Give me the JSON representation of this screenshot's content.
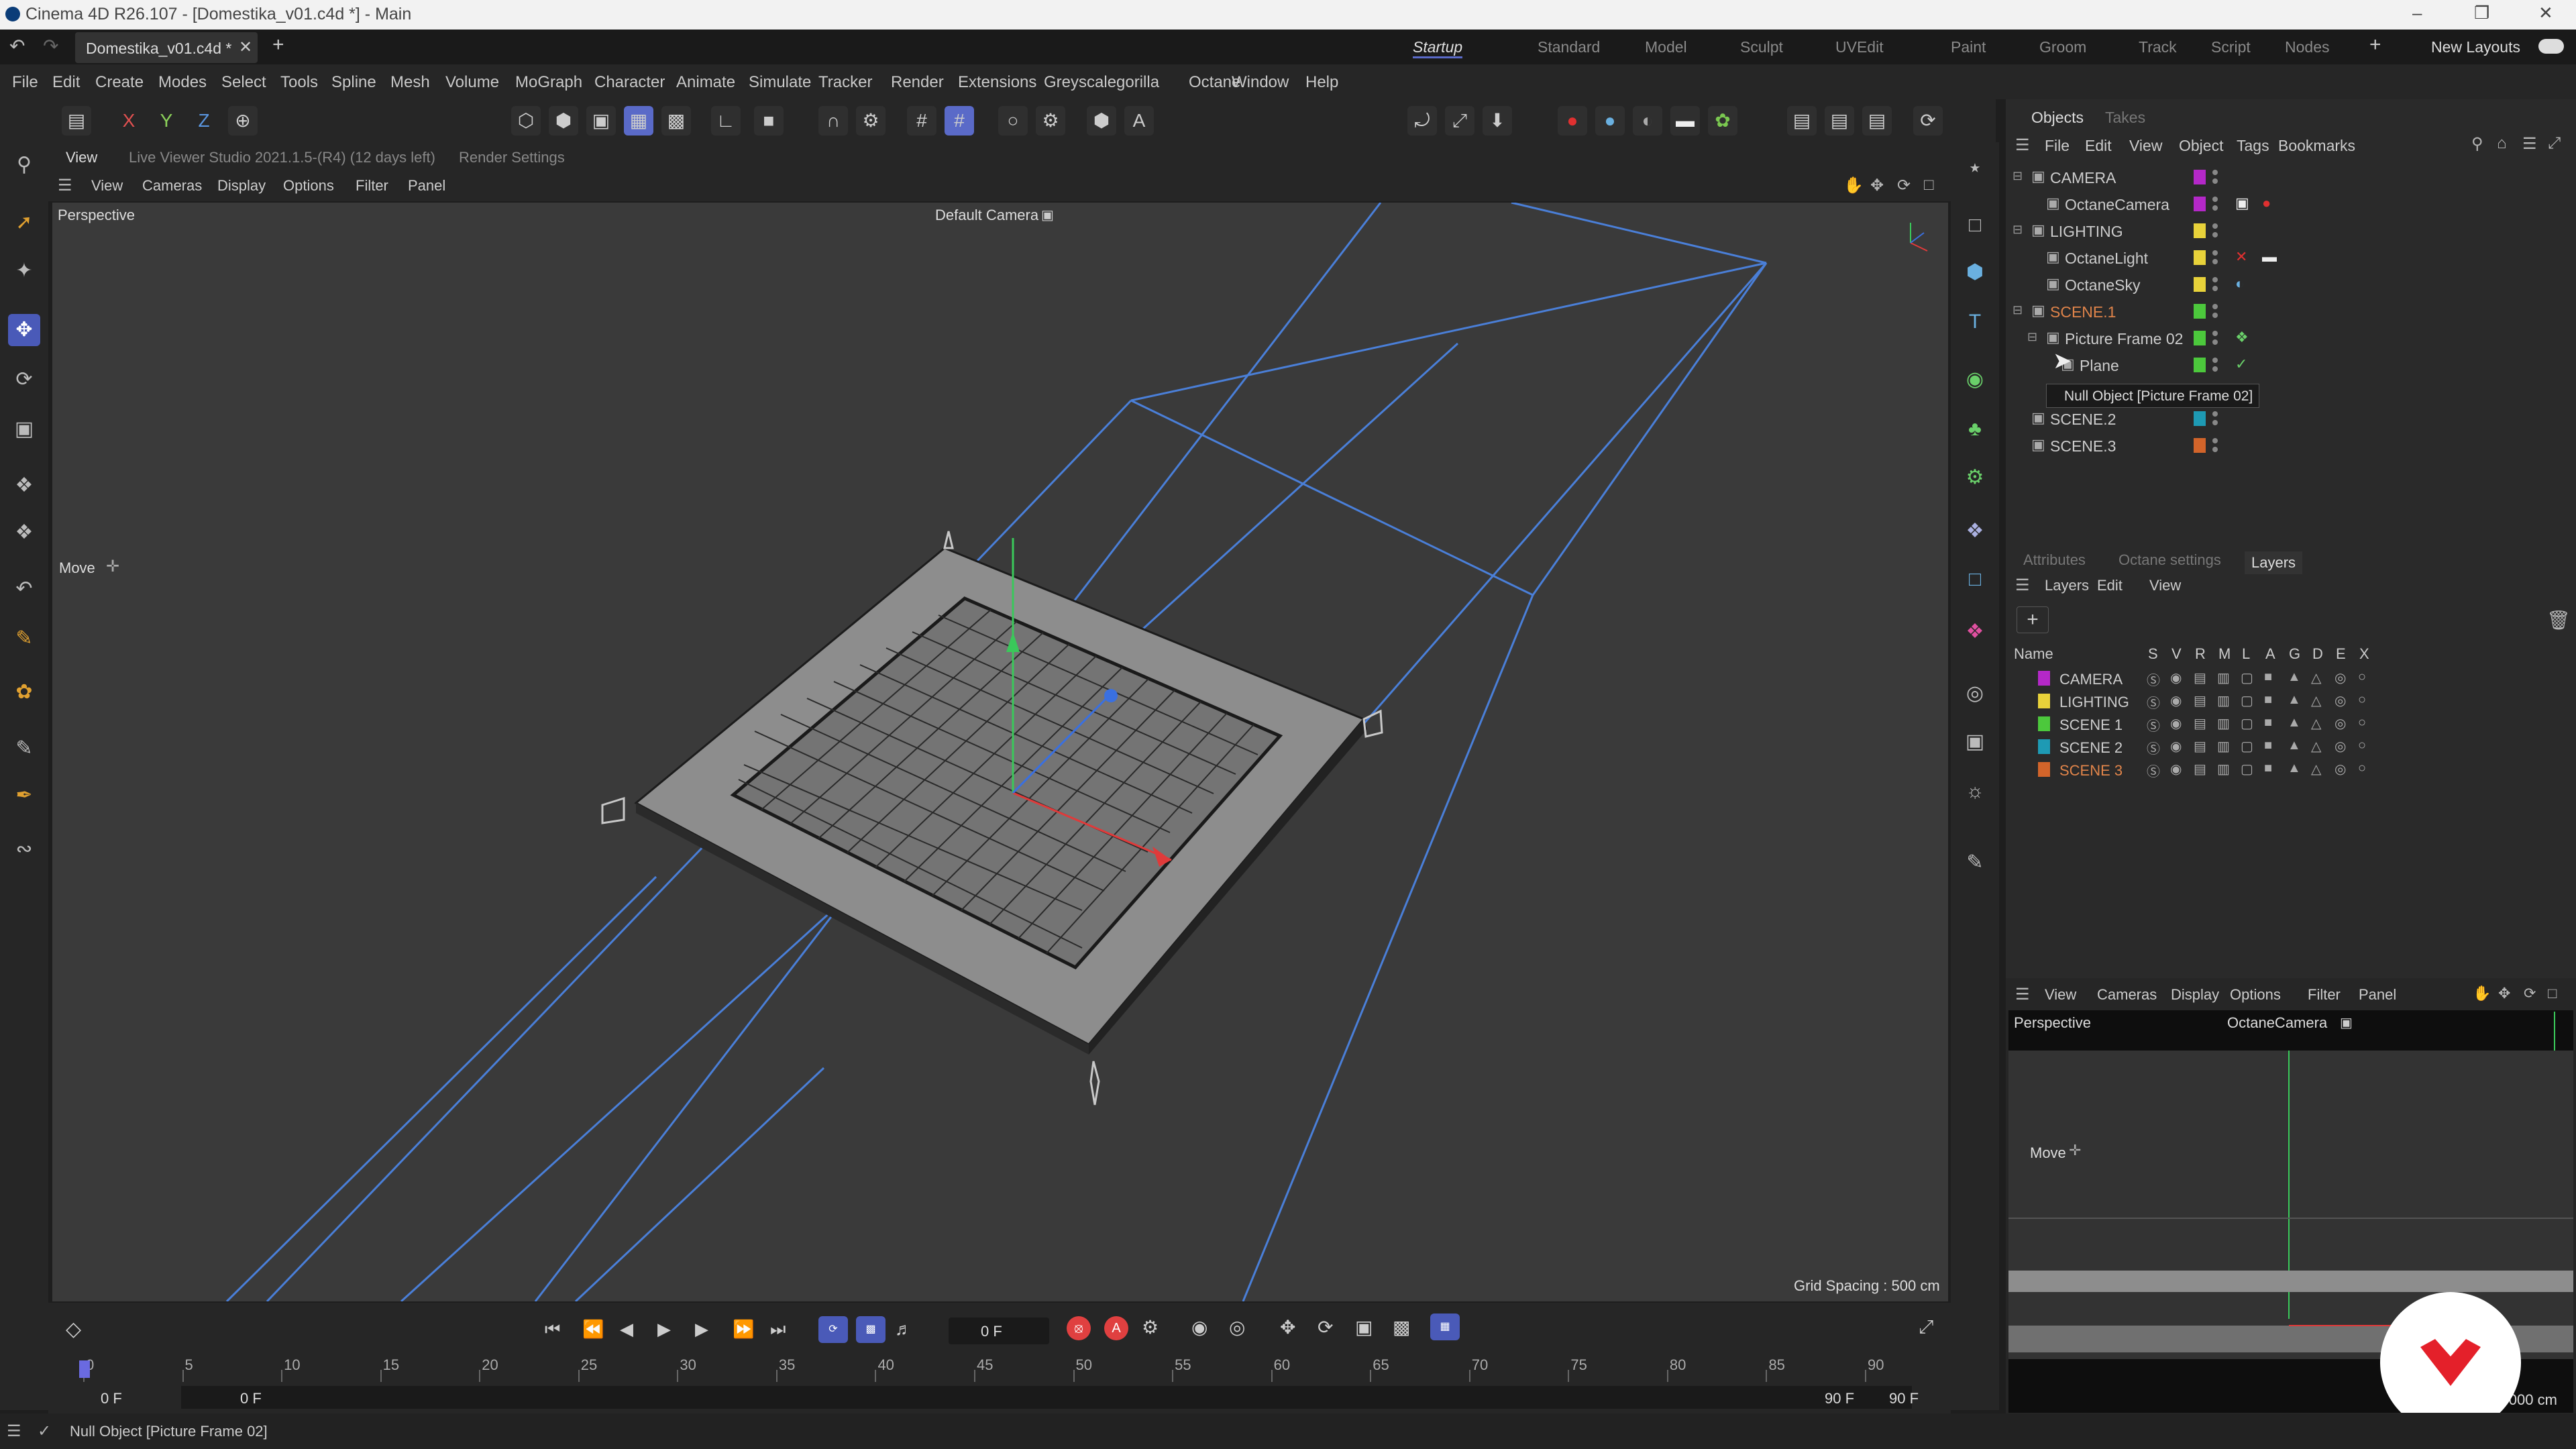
{
  "window": {
    "title": "Cinema 4D R26.107 - [Domestika_v01.c4d *] - Main"
  },
  "tabs": {
    "file_tab": "Domestika_v01.c4d *",
    "layouts": [
      "Startup",
      "Standard",
      "Model",
      "Sculpt",
      "UVEdit",
      "Paint",
      "Groom",
      "Track",
      "Script",
      "Nodes"
    ],
    "new_layouts": "New Layouts"
  },
  "menu": [
    "File",
    "Edit",
    "Create",
    "Modes",
    "Select",
    "Tools",
    "Spline",
    "Mesh",
    "Volume",
    "MoGraph",
    "Character",
    "Animate",
    "Simulate",
    "Tracker",
    "Render",
    "Extensions",
    "Greyscalegorilla",
    "Octane",
    "Window",
    "Help"
  ],
  "coords": [
    "X",
    "Y",
    "Z"
  ],
  "viewport": {
    "tab_view": "View",
    "live_viewer": "Live Viewer Studio 2021.1.5-(R4) (12 days left)",
    "render_settings": "Render Settings",
    "menu": [
      "View",
      "Cameras",
      "Display",
      "Options",
      "Filter",
      "Panel"
    ],
    "label": "Perspective",
    "camera": "Default Camera",
    "tool": "Move",
    "grid": "Grid Spacing : 500 cm"
  },
  "objects": {
    "tabs": [
      "Objects",
      "Takes"
    ],
    "menu": [
      "File",
      "Edit",
      "View",
      "Object",
      "Tags",
      "Bookmarks"
    ],
    "items": [
      {
        "name": "CAMERA",
        "color": "#b428c8"
      },
      {
        "name": "OctaneCamera",
        "color": "#b428c8"
      },
      {
        "name": "LIGHTING",
        "color": "#e8d23a"
      },
      {
        "name": "OctaneLight",
        "color": "#e8d23a"
      },
      {
        "name": "OctaneSky",
        "color": "#e8d23a"
      },
      {
        "name": "SCENE.1",
        "color": "#4cc83c"
      },
      {
        "name": "Picture Frame 02",
        "color": "#4cc83c"
      },
      {
        "name": "Plane",
        "color": "#4cc83c"
      },
      {
        "name": "SCENE.2",
        "color": "#1e9ab4"
      },
      {
        "name": "SCENE.3",
        "color": "#d2642a"
      }
    ],
    "tooltip": "Null Object [Picture Frame 02]"
  },
  "layers": {
    "tabs": [
      "Attributes",
      "Octane settings",
      "Layers"
    ],
    "menu": [
      "Layers",
      "Edit",
      "View"
    ],
    "name_header": "Name",
    "cols": [
      "S",
      "V",
      "R",
      "M",
      "L",
      "A",
      "G",
      "D",
      "E",
      "X"
    ],
    "items": [
      {
        "name": "CAMERA",
        "color": "#b428c8"
      },
      {
        "name": "LIGHTING",
        "color": "#e8d23a"
      },
      {
        "name": "SCENE 1",
        "color": "#4cc83c"
      },
      {
        "name": "SCENE 2",
        "color": "#1e9ab4"
      },
      {
        "name": "SCENE 3",
        "color": "#d2642a"
      }
    ]
  },
  "mini": {
    "menu": [
      "View",
      "Cameras",
      "Display",
      "Options",
      "Filter",
      "Panel"
    ],
    "label": "Perspective",
    "camera": "OctaneCamera",
    "tool": "Move",
    "grid": "Grid Spacing : 5000 cm"
  },
  "timeline": {
    "frame": "0 F",
    "ticks": [
      "0",
      "5",
      "10",
      "15",
      "20",
      "25",
      "30",
      "35",
      "40",
      "45",
      "50",
      "55",
      "60",
      "65",
      "70",
      "75",
      "80",
      "85",
      "90"
    ],
    "start": "0 F",
    "start2": "0 F",
    "end": "90 F",
    "end2": "90 F"
  },
  "status": {
    "text": "Null Object [Picture Frame 02]"
  }
}
